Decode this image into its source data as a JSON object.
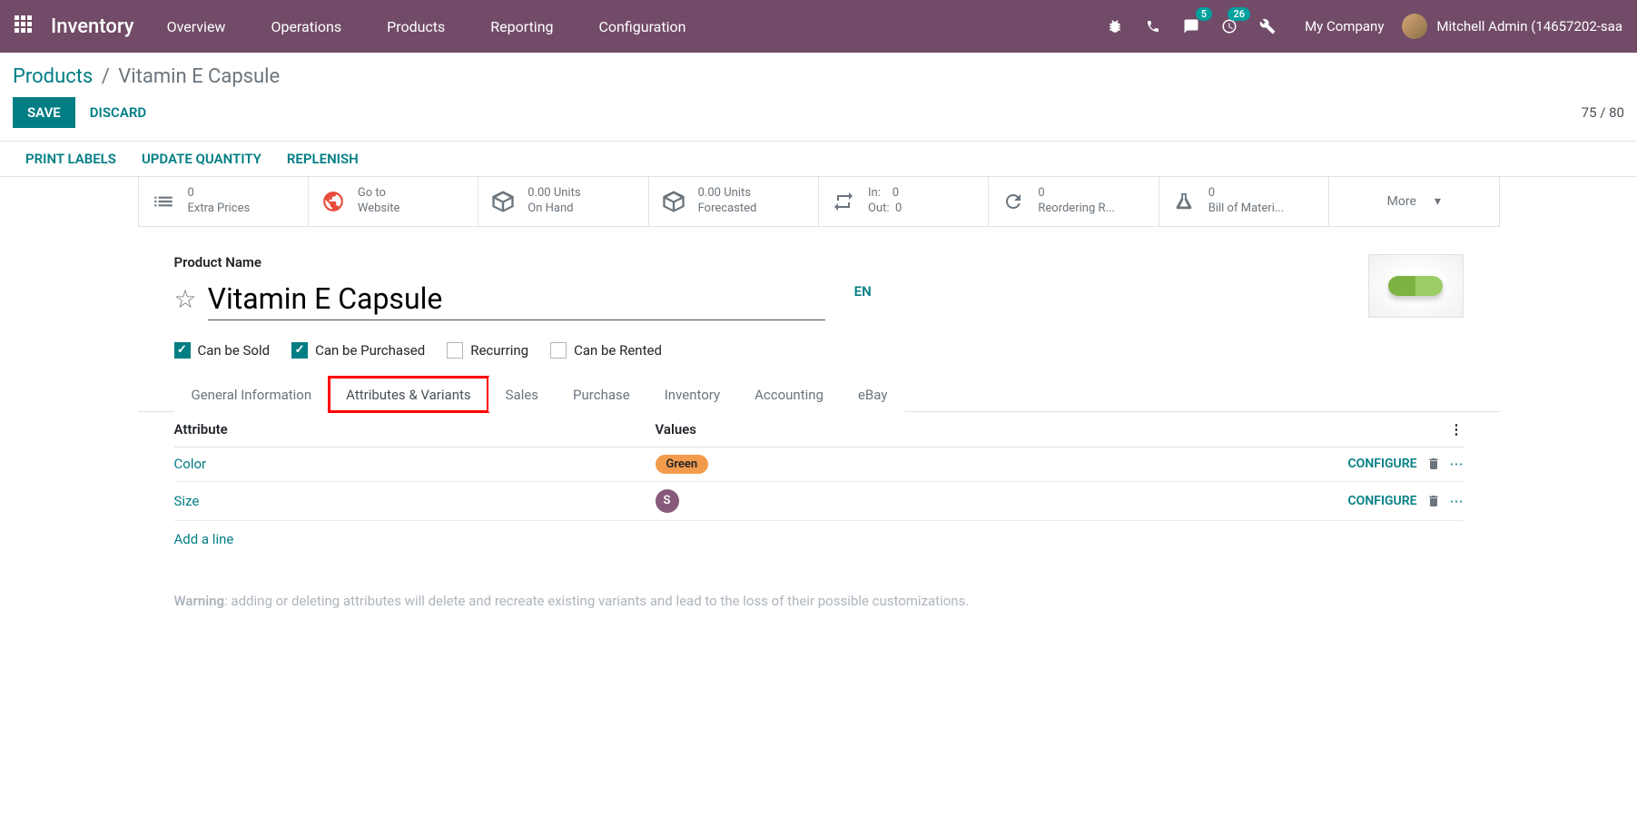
{
  "navbar": {
    "brand": "Inventory",
    "items": [
      "Overview",
      "Operations",
      "Products",
      "Reporting",
      "Configuration"
    ],
    "chat_badge": "5",
    "sched_badge": "26",
    "company": "My Company",
    "user": "Mitchell Admin (14657202-saa"
  },
  "breadcrumb": {
    "parent": "Products",
    "current": "Vitamin E Capsule"
  },
  "actions": {
    "save": "SAVE",
    "discard": "DISCARD",
    "pager": "75 / 80"
  },
  "status_buttons": [
    "PRINT LABELS",
    "UPDATE QUANTITY",
    "REPLENISH"
  ],
  "stats": {
    "extra_prices": {
      "value": "0",
      "label": "Extra Prices"
    },
    "website": {
      "value": "Go to",
      "label": "Website"
    },
    "on_hand": {
      "value": "0.00 Units",
      "label": "On Hand"
    },
    "forecasted": {
      "value": "0.00 Units",
      "label": "Forecasted"
    },
    "in_label": "In:",
    "in_val": "0",
    "out_label": "Out:",
    "out_val": "0",
    "reorder": {
      "value": "0",
      "label": "Reordering R..."
    },
    "bom": {
      "value": "0",
      "label": "Bill of Materi..."
    },
    "more": "More"
  },
  "form": {
    "name_label": "Product Name",
    "name": "Vitamin E Capsule",
    "lang": "EN",
    "checkboxes": {
      "sold": "Can be Sold",
      "purchased": "Can be Purchased",
      "recurring": "Recurring",
      "rented": "Can be Rented"
    }
  },
  "tabs": [
    "General Information",
    "Attributes & Variants",
    "Sales",
    "Purchase",
    "Inventory",
    "Accounting",
    "eBay"
  ],
  "active_tab_index": 1,
  "attr_table": {
    "headers": {
      "attribute": "Attribute",
      "values": "Values"
    },
    "rows": [
      {
        "attribute": "Color",
        "value": "Green",
        "tag_class": "orange",
        "configure": "CONFIGURE"
      },
      {
        "attribute": "Size",
        "value": "S",
        "tag_class": "purple",
        "configure": "CONFIGURE"
      }
    ],
    "add_line": "Add a line"
  },
  "warning": {
    "prefix": "Warning",
    "text": ": adding or deleting attributes will delete and recreate existing variants and lead to the loss of their possible customizations."
  }
}
